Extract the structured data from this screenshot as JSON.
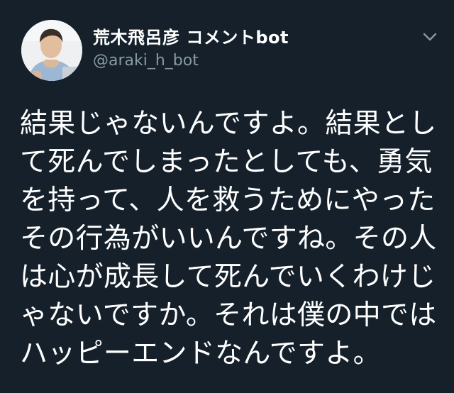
{
  "header": {
    "display_name": "荒木飛呂彦 コメントbot",
    "handle": "@araki_h_bot",
    "avatar_icon": "person-photo-icon",
    "menu_icon": "chevron-down-icon"
  },
  "tweet": {
    "lines": [
      "結果じゃないんですよ。結果とし",
      "て死んでしまったとしても、勇気",
      "を持って、人を救うためにやった",
      "その行為がいいんですね。その人",
      "は心が成長して死んでいくわけじ",
      "ゃないですか。それは僕の中では",
      "ハッピーエンドなんですよ。"
    ]
  },
  "colors": {
    "background": "#15202b",
    "text": "#ffffff",
    "secondary_text": "#8899a6"
  }
}
